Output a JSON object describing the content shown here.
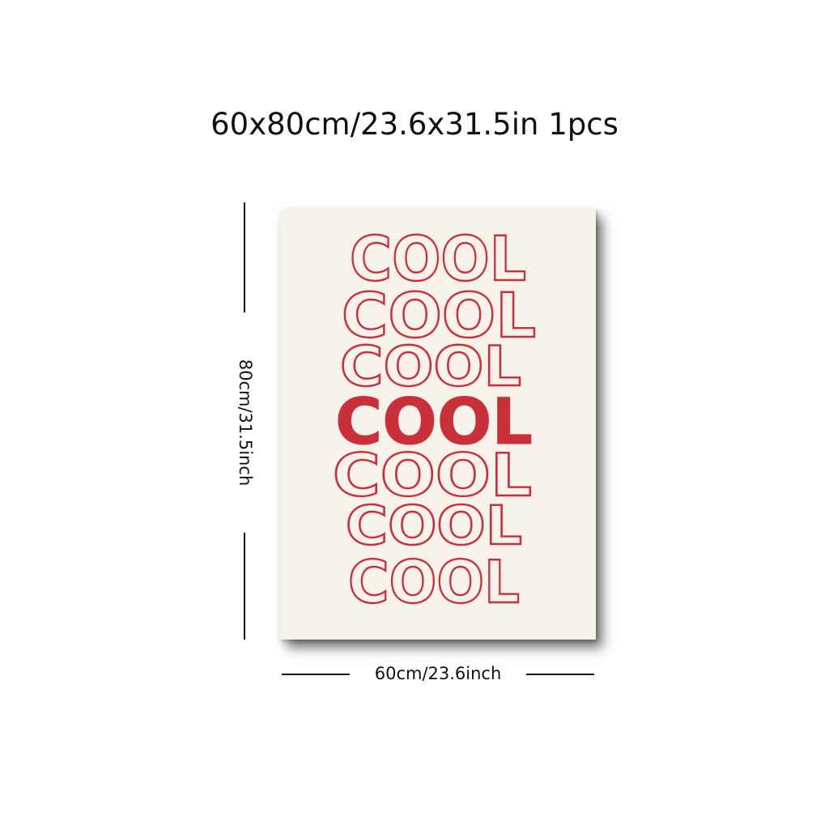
{
  "product": {
    "headline": "60x80cm/23.6x31.5in 1pcs",
    "height_label": "80cm/31.5inch",
    "width_label": "60cm/23.6inch"
  },
  "artwork": {
    "word": "COOL",
    "rows": [
      {
        "word": "COOL",
        "style": "outline"
      },
      {
        "word": "COOL",
        "style": "outline"
      },
      {
        "word": "COOL",
        "style": "outline"
      },
      {
        "word": "COOL",
        "style": "solid"
      },
      {
        "word": "COOL",
        "style": "outline"
      },
      {
        "word": "COOL",
        "style": "outline"
      },
      {
        "word": "COOL",
        "style": "outline"
      }
    ],
    "colors": {
      "background": "#f7f3ea",
      "ink": "#c9303a"
    }
  }
}
